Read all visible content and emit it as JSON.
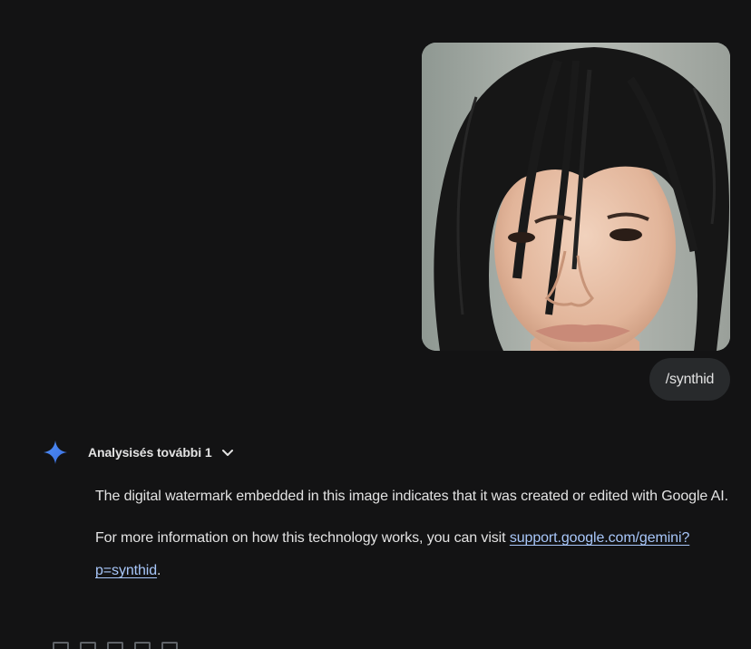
{
  "user_message": {
    "image_alt": "portrait photo",
    "text": "/synthid"
  },
  "model_response": {
    "analysis_label": "Analysisés további 1",
    "paragraph_1": "The digital watermark embedded in this image indicates that it was created or edited with Google AI.",
    "paragraph_2_prefix": "For more information on how this technology works, you can visit ",
    "link_text": "support.google.com/gemini?p=synthid",
    "paragraph_2_suffix": "."
  },
  "colors": {
    "background": "#131314",
    "bubble": "#282a2c",
    "text": "#e3e3e3",
    "link": "#a8c7fa",
    "spark": "#4285f4"
  },
  "icons": [
    "gemini-spark-icon",
    "chevron-down-icon"
  ]
}
